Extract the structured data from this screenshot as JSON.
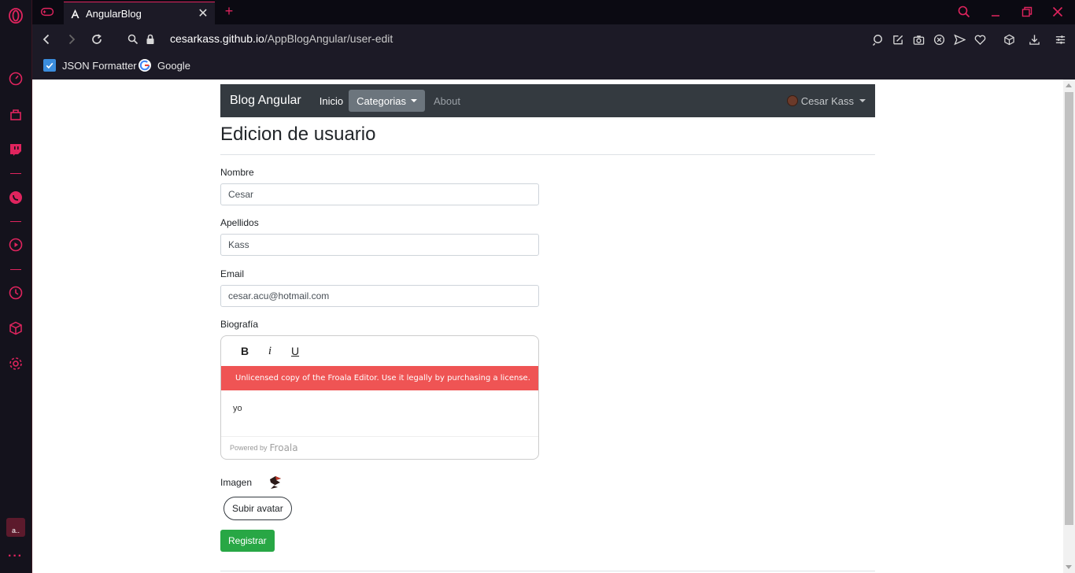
{
  "browser": {
    "tab_title": "AngularBlog",
    "new_tab": "+",
    "url_host": "cesarkass.github.io",
    "url_path": "/AppBlogAngular/user-edit",
    "bookmarks": [
      {
        "label": "JSON Formatter",
        "icon": "checkbox-icon"
      },
      {
        "label": "Google",
        "icon": "google-icon"
      }
    ],
    "accent_color": "#e0245e"
  },
  "sidebar_tile_text": "a..",
  "navbar": {
    "brand": "Blog Angular",
    "links": [
      "Inicio",
      "Categorias",
      "About"
    ],
    "user": "Cesar Kass"
  },
  "page": {
    "title": "Edicion de usuario"
  },
  "form": {
    "nombre_label": "Nombre",
    "nombre_value": "Cesar",
    "apellidos_label": "Apellidos",
    "apellidos_value": "Kass",
    "email_label": "Email",
    "email_value": "cesar.acu@hotmail.com",
    "biografia_label": "Biografía",
    "editor": {
      "bold": "B",
      "italic": "i",
      "underline": "U",
      "warning": "Unlicensed copy of the Froala Editor. Use it legally by purchasing a license.",
      "content": "yo",
      "powered_by": "Powered by",
      "brand": "Froala"
    },
    "imagen_label": "Imagen",
    "avatar_button": "Subir avatar",
    "submit_button": "Registrar"
  }
}
